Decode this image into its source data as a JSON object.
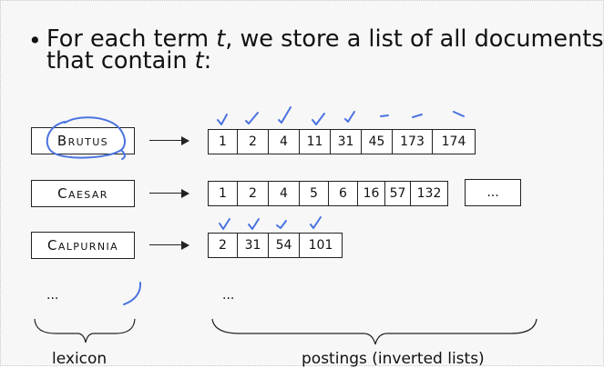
{
  "bullet": {
    "marker": "•",
    "line1_before": "For each term ",
    "term_var": "t",
    "line1_after": ", we store a list of all documents",
    "line2_before": "that contain ",
    "line2_var": "t",
    "line2_after": ":"
  },
  "rows": [
    {
      "term": "Brutus",
      "postings": [
        "1",
        "2",
        "4",
        "11",
        "31",
        "45",
        "173",
        "174"
      ]
    },
    {
      "term": "Caesar",
      "postings": [
        "1",
        "2",
        "4",
        "5",
        "6",
        "16",
        "57",
        "132"
      ],
      "extra": "..."
    },
    {
      "term": "Calpurnia",
      "postings": [
        "2",
        "31",
        "54",
        "101"
      ]
    }
  ],
  "ellipses": {
    "lexicon": "...",
    "postings": "..."
  },
  "captions": {
    "lexicon": "lexicon",
    "postings": "postings (inverted lists)"
  },
  "colors": {
    "annotation": "#4a73e0",
    "ink": "#111111",
    "slide_bg": "#f7f7f7"
  },
  "annotations": {
    "brutus_circled": true,
    "brutus_checked_postings": [
      "1",
      "2",
      "4",
      "11",
      "31"
    ],
    "brutus_dashed_postings": [
      "45",
      "173",
      "174"
    ],
    "calpurnia_checked_postings": [
      "2",
      "31",
      "54",
      "101"
    ]
  }
}
